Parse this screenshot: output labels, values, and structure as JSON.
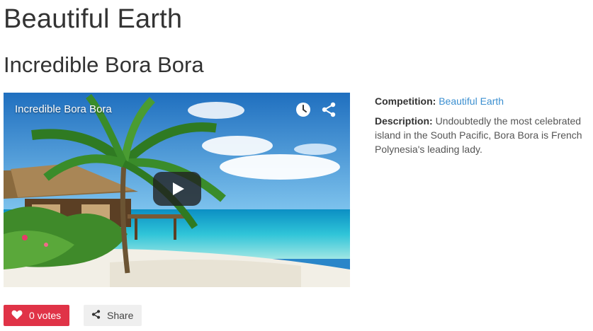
{
  "page": {
    "title": "Beautiful Earth",
    "entry_title": "Incredible Bora Bora"
  },
  "video": {
    "title": "Incredible Bora Bora",
    "icons": [
      "clock-icon",
      "share-icon",
      "play-icon"
    ]
  },
  "details": {
    "competition_label": "Competition:",
    "competition_value": "Beautiful Earth",
    "description_label": "Description:",
    "description_text": "Undoubtedly the most celebrated island in the South Pacific, Bora Bora is French Polynesia's leading lady."
  },
  "actions": {
    "vote_label": "0 votes",
    "share_label": "Share"
  },
  "colors": {
    "vote_button": "#e03347",
    "link": "#3b8fd0",
    "share_button": "#efefef"
  }
}
